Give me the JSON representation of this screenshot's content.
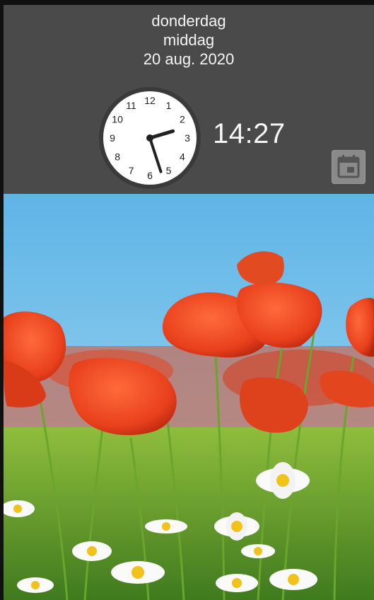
{
  "header": {
    "day": "donderdag",
    "daypart": "middag",
    "date": "20 aug. 2020",
    "time": "14:27"
  },
  "clock": {
    "numerals": [
      "12",
      "1",
      "2",
      "3",
      "4",
      "5",
      "6",
      "7",
      "8",
      "9",
      "10",
      "11"
    ],
    "hours": 14,
    "minutes": 27
  },
  "calendar_button": {
    "icon": "calendar-icon"
  },
  "wallpaper": {
    "subject": "poppy-field",
    "sky": "#7cc3ea",
    "poppy": "#e8401c"
  }
}
